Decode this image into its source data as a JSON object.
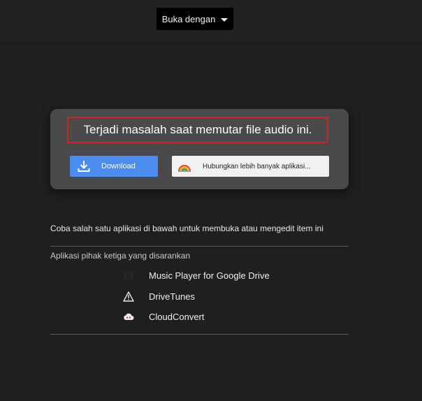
{
  "toolbar": {
    "open_with_label": "Buka dengan"
  },
  "error_card": {
    "message": "Terjadi masalah saat memutar file audio ini.",
    "download_label": "Download",
    "connect_label": "Hubungkan lebih banyak aplikasi..."
  },
  "apps_section": {
    "intro": "Coba salah satu aplikasi di bawah untuk membuka atau mengedit item ini",
    "suggested_label": "Aplikasi pihak ketiga yang disarankan",
    "items": [
      {
        "label": "Music Player for Google Drive",
        "icon": "headphones-icon"
      },
      {
        "label": "DriveTunes",
        "icon": "warning-triangle-icon"
      },
      {
        "label": "CloudConvert",
        "icon": "cloud-icon"
      }
    ]
  },
  "colors": {
    "background": "#1f1f1f",
    "card": "#4a4a4c",
    "download_button": "#4a8cf0",
    "error_outline": "#d0231e"
  }
}
